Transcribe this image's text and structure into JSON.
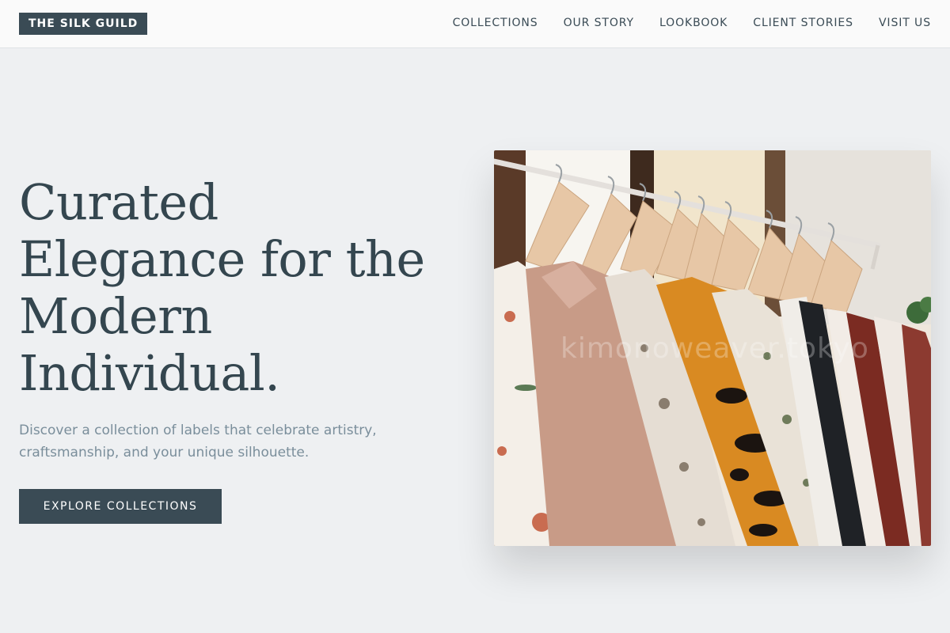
{
  "header": {
    "brand": "THE SILK GUILD",
    "nav": [
      "COLLECTIONS",
      "OUR STORY",
      "LOOKBOOK",
      "CLIENT STORIES",
      "VISIT US"
    ]
  },
  "hero": {
    "title_lines": [
      "Curated",
      "Elegance for the",
      "Modern",
      "Individual."
    ],
    "subtitle": "Discover a collection of labels that celebrate artistry, craftsmanship, and your unique silhouette.",
    "cta_label": "EXPLORE COLLECTIONS",
    "image_watermark": "kimonoweaver.tokyo",
    "image_subject": "clothing-rack-photo"
  },
  "colors": {
    "accent": "#3a4b55",
    "background": "#eef0f2",
    "muted_text": "#7a8e9b"
  }
}
